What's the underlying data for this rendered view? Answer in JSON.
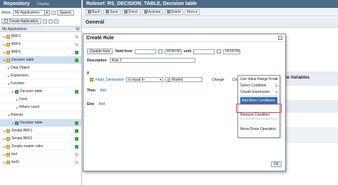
{
  "repository": {
    "title": "Repository",
    "catalog_tab": "Catalog",
    "show_label": "Show:",
    "show_value": "My Applications",
    "search_button": "Search",
    "create_application_button": "Create Application",
    "tree_header": "My Applications",
    "tree_header_col": "St",
    "tree": [
      {
        "label": "BRF3",
        "indent": 0,
        "arrow": "▸",
        "status": "gray",
        "icon": "folder"
      },
      {
        "label": "BRF4",
        "indent": 0,
        "arrow": "▸",
        "status": "gray",
        "icon": "folder"
      },
      {
        "label": "BRF5",
        "indent": 0,
        "arrow": "▸",
        "status": "green",
        "icon": "folder"
      },
      {
        "label": "Decision table",
        "indent": 0,
        "arrow": "▾",
        "status": "green",
        "icon": "folder",
        "selected": true
      },
      {
        "label": "Data Object",
        "indent": 1,
        "arrow": "▸",
        "status": "",
        "icon": ""
      },
      {
        "label": "Expression",
        "indent": 1,
        "arrow": "▸",
        "status": "",
        "icon": ""
      },
      {
        "label": "Function",
        "indent": 1,
        "arrow": "▾",
        "status": "",
        "icon": ""
      },
      {
        "label": "Decision table",
        "indent": 2,
        "arrow": "▸",
        "status": "green",
        "icon": "rule"
      },
      {
        "label": "Uses",
        "indent": 3,
        "arrow": "▸",
        "status": "",
        "icon": ""
      },
      {
        "label": "Where Used",
        "indent": 3,
        "arrow": "▸",
        "status": "",
        "icon": ""
      },
      {
        "label": "Ruleset",
        "indent": 1,
        "arrow": "▾",
        "status": "",
        "icon": ""
      },
      {
        "label": "Decision table",
        "indent": 2,
        "arrow": "▸",
        "status": "green",
        "icon": "rule",
        "selected": true
      },
      {
        "label": "Simple BRF1",
        "indent": 0,
        "arrow": "▸",
        "status": "green",
        "icon": "folder"
      },
      {
        "label": "Simple BRF2",
        "indent": 0,
        "arrow": "▸",
        "status": "green",
        "icon": "folder"
      },
      {
        "label": "Simple master rules",
        "indent": 0,
        "arrow": "▸",
        "status": "green",
        "icon": "folder"
      },
      {
        "label": "test",
        "indent": 0,
        "arrow": "▸",
        "status": "gray",
        "icon": "folder"
      },
      {
        "label": "test2",
        "indent": 0,
        "arrow": "▸",
        "status": "gray",
        "icon": "folder"
      }
    ]
  },
  "main": {
    "title": "Ruleset: RS_DECISION_TABLE, Decision table",
    "toolbar": {
      "back": "Back",
      "save": "Save",
      "check": "Check",
      "activate": "Activate",
      "delete": "Delete",
      "more": "More"
    },
    "general_header": "General",
    "variables_label": "he Variables"
  },
  "modal": {
    "title": "Create Rule",
    "disable_rule_button": "Disable Rule",
    "valid_from_label": "Valid from",
    "valid_from_time": "00:00:00",
    "until_label": "until",
    "until_time": "00:00:00",
    "description_label": "Description",
    "description_value": "Rule 1",
    "if_label": "If",
    "condition": {
      "field": "Flight_Destination",
      "operator": "is equal to",
      "value": "Madrid",
      "change_link": "Change"
    },
    "change_condition_dropdown": "Change Condition",
    "then_label": "Then",
    "then_add": "Add",
    "else_label": "Else",
    "else_add": "Add",
    "ok_button": "OK"
  },
  "context_menu": {
    "items": [
      {
        "label": "Use Value Range From",
        "has_sub": true
      },
      {
        "label": "Select Condition",
        "has_sub": true
      },
      {
        "label": "Create Expression",
        "has_sub": true
      },
      {
        "separator": true
      },
      {
        "label": "Add More Conditions",
        "highlighted": true
      },
      {
        "separator": true
      },
      {
        "label": "Remove Condition"
      },
      {
        "separator": true
      },
      {
        "label": "Move Down Operation"
      }
    ]
  }
}
